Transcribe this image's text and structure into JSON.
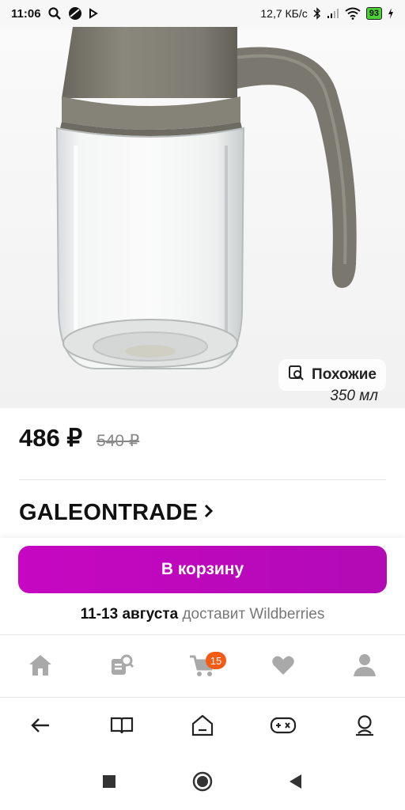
{
  "status_bar": {
    "time": "11:06",
    "speed": "12,7 КБ/с",
    "battery": "93"
  },
  "product": {
    "similar_label": "Похожие",
    "volume": "350 мл",
    "price_current": "486 ₽",
    "price_old": "540 ₽",
    "brand": "GALEONTRADE",
    "brand_chevron": "›"
  },
  "cart": {
    "button_label": "В корзину",
    "delivery_dates": "11-13 августа",
    "delivery_text": "доставит Wildberries"
  },
  "tabbar": {
    "items": [
      {
        "icon": "home-icon"
      },
      {
        "icon": "catalog-search-icon"
      },
      {
        "icon": "cart-icon",
        "badge": "15"
      },
      {
        "icon": "heart-icon"
      },
      {
        "icon": "profile-icon"
      }
    ]
  },
  "browser_bar": {
    "items": [
      "back-arrow-icon",
      "book-icon",
      "home-tab-icon",
      "gamepad-icon",
      "account-icon"
    ]
  },
  "colors": {
    "accent": "#c707c2",
    "badge": "#f45b14",
    "icon_gray": "#a9a9a9"
  }
}
